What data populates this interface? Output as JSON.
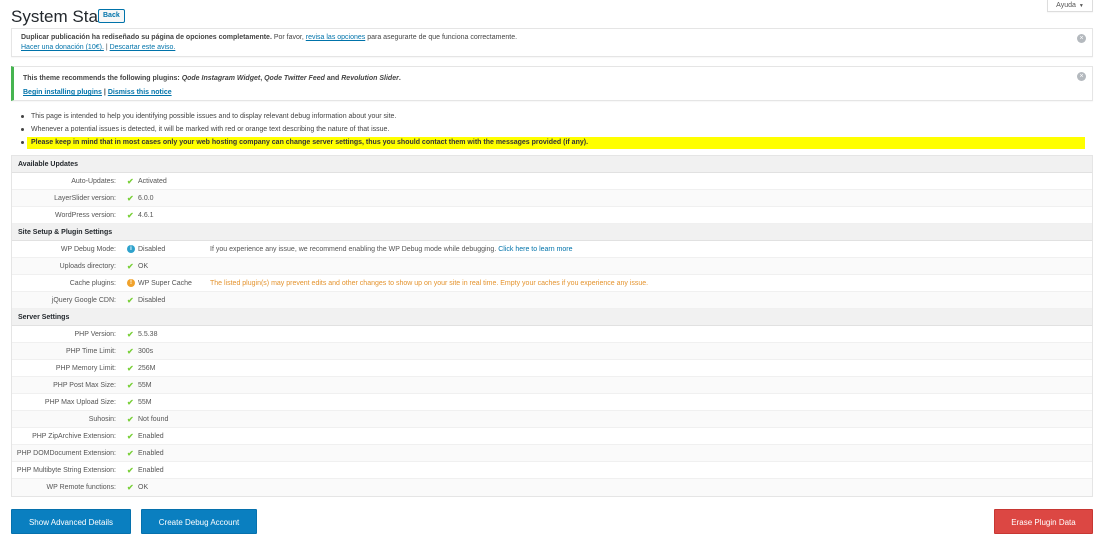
{
  "header": {
    "title": "System Status",
    "back_label": "Back",
    "help_label": "Ayuda"
  },
  "notices": {
    "dup": {
      "text_bold": "Duplicar publicación ha rediseñado su página de opciones completamente.",
      "text_plain": " Por favor, ",
      "link_options": "revisa las opciones",
      "text_after": " para asegurarte de que funciona correctamente.",
      "link_donate": "Hacer una donación (10€).",
      "separator": " | ",
      "link_dismiss": "Descartar este aviso."
    },
    "plugins": {
      "text_start": "This theme recommends the following plugins: ",
      "plugin1": "Qode Instagram Widget",
      "comma": ", ",
      "plugin2": "Qode Twitter Feed",
      "and": " and ",
      "plugin3": "Revolution Slider",
      "period": ".",
      "link_install": "Begin installing plugins",
      "separator": " | ",
      "link_dismiss": "Dismiss this notice"
    }
  },
  "intro": [
    "This page is intended to help you identifying possible issues and to display relevant debug information about your site.",
    "Whenever a potential issues is detected, it will be marked with red or orange text describing the nature of that issue.",
    "Please keep in mind that in most cases only your web hosting company can change server settings, thus you should contact them with the messages provided (if any)."
  ],
  "sections": {
    "updates": {
      "title": "Available Updates",
      "rows": [
        {
          "label": "Auto-Updates:",
          "value": "Activated"
        },
        {
          "label": "LayerSlider version:",
          "value": "6.0.0"
        },
        {
          "label": "WordPress version:",
          "value": "4.6.1"
        }
      ]
    },
    "setup": {
      "title": "Site Setup & Plugin Settings",
      "rows": [
        {
          "label": "WP Debug Mode:",
          "value": "Disabled",
          "note": "If you experience any issue, we recommend enabling the WP Debug mode while debugging.",
          "note_link": "Click here to learn more"
        },
        {
          "label": "Uploads directory:",
          "value": "OK"
        },
        {
          "label": "Cache plugins:",
          "value": "WP Super Cache",
          "note": "The listed plugin(s) may prevent edits and other changes to show up on your site in real time. Empty your caches if you experience any issue."
        },
        {
          "label": "jQuery Google CDN:",
          "value": "Disabled"
        }
      ]
    },
    "server": {
      "title": "Server Settings",
      "rows": [
        {
          "label": "PHP Version:",
          "value": "5.5.38"
        },
        {
          "label": "PHP Time Limit:",
          "value": "300s"
        },
        {
          "label": "PHP Memory Limit:",
          "value": "256M"
        },
        {
          "label": "PHP Post Max Size:",
          "value": "55M"
        },
        {
          "label": "PHP Max Upload Size:",
          "value": "55M"
        },
        {
          "label": "Suhosin:",
          "value": "Not found"
        },
        {
          "label": "PHP ZipArchive Extension:",
          "value": "Enabled"
        },
        {
          "label": "PHP DOMDocument Extension:",
          "value": "Enabled"
        },
        {
          "label": "PHP Multibyte String Extension:",
          "value": "Enabled"
        },
        {
          "label": "WP Remote functions:",
          "value": "OK"
        }
      ]
    }
  },
  "icons": {
    "check": "✔",
    "info": "i",
    "warn": "!",
    "close": "×",
    "caret": "▼"
  },
  "buttons": {
    "advanced": "Show Advanced Details",
    "debug": "Create Debug Account",
    "erase": "Erase Plugin Data"
  },
  "colors": {
    "ok": "#7ad03a",
    "info": "#2ea2cc",
    "warn": "#e4932d",
    "primary": "#0a7fc0",
    "danger": "#dc4743",
    "highlight": "#ffff00"
  }
}
